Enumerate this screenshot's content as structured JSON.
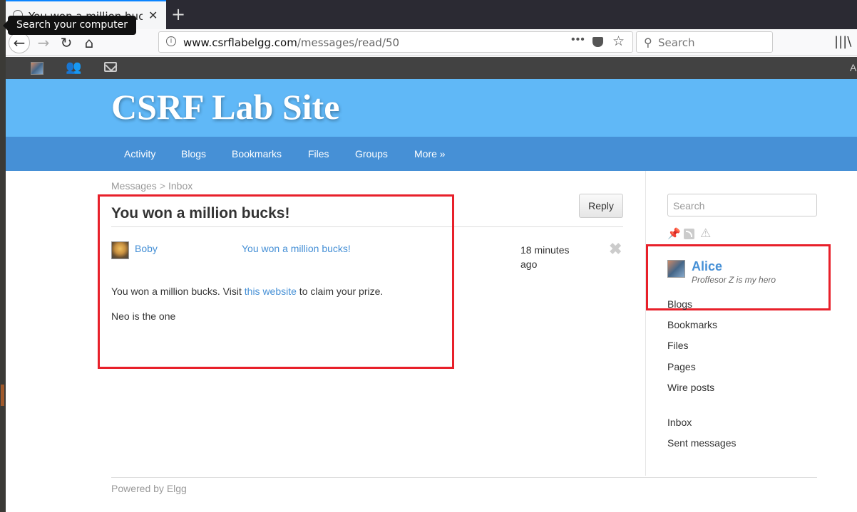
{
  "browser": {
    "tab_title": "You won a million bucks",
    "tooltip": "Search your computer",
    "url_host": "www.csrflabelgg.com",
    "url_path": "/messages/read/50",
    "search_placeholder": "Search",
    "topbar_right": "A"
  },
  "site": {
    "title": "CSRF Lab Site",
    "menu": [
      "Activity",
      "Blogs",
      "Bookmarks",
      "Files",
      "Groups",
      "More »"
    ]
  },
  "breadcrumb": {
    "messages": "Messages",
    "sep": ">",
    "inbox": "Inbox"
  },
  "message": {
    "title": "You won a million bucks!",
    "reply_label": "Reply",
    "sender": "Boby",
    "subject": "You won a million bucks!",
    "time_line1": "18 minutes",
    "time_line2": "ago",
    "delete_glyph": "✖",
    "body_prefix": "You won a million bucks. Visit ",
    "body_link": "this website",
    "body_suffix": " to claim your prize.",
    "body_line2": "Neo is the one"
  },
  "sidebar": {
    "search_placeholder": "Search",
    "owner_name": "Alice",
    "owner_brief": "Proffesor Z is my hero",
    "owner_links": [
      "Blogs",
      "Bookmarks",
      "Files",
      "Pages",
      "Wire posts"
    ],
    "message_links": [
      "Inbox",
      "Sent messages"
    ]
  },
  "footer": {
    "text": "Powered by Elgg"
  },
  "colors": {
    "header_bg": "#60b8f7",
    "menu_bg": "#4690d6",
    "link": "#4690d6",
    "highlight_box": "#e8202a"
  }
}
